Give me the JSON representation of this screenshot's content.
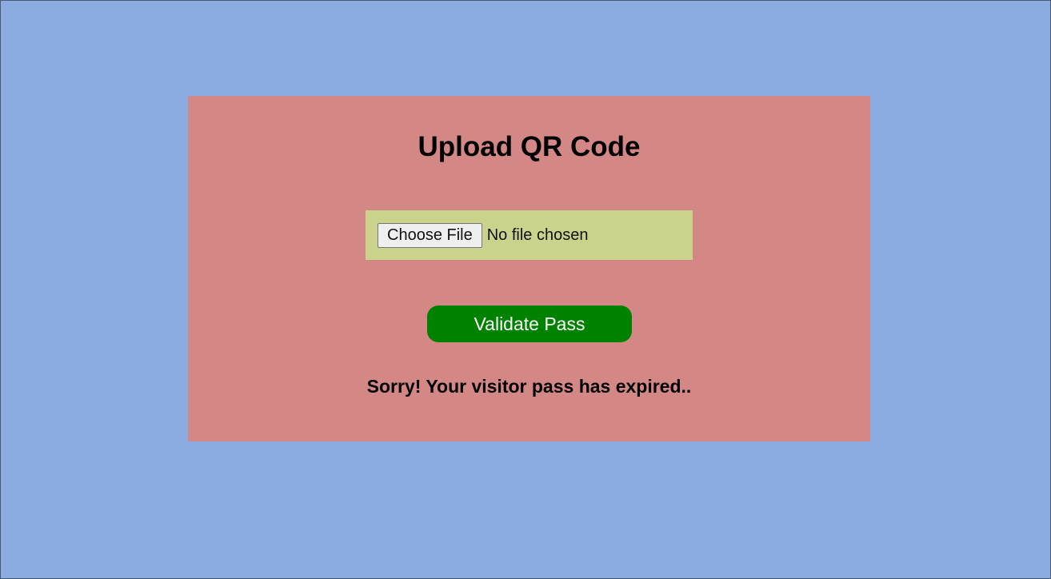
{
  "card": {
    "title": "Upload QR Code"
  },
  "file_input": {
    "button_label": "Choose File",
    "status": "No file chosen"
  },
  "validate_button": {
    "label": "Validate Pass"
  },
  "message": {
    "text": "Sorry! Your visitor pass has expired.."
  },
  "colors": {
    "page_background": "#8cabe0",
    "card_background": "#d38886",
    "file_box_background": "#cbd28c",
    "validate_button": "#008200"
  }
}
